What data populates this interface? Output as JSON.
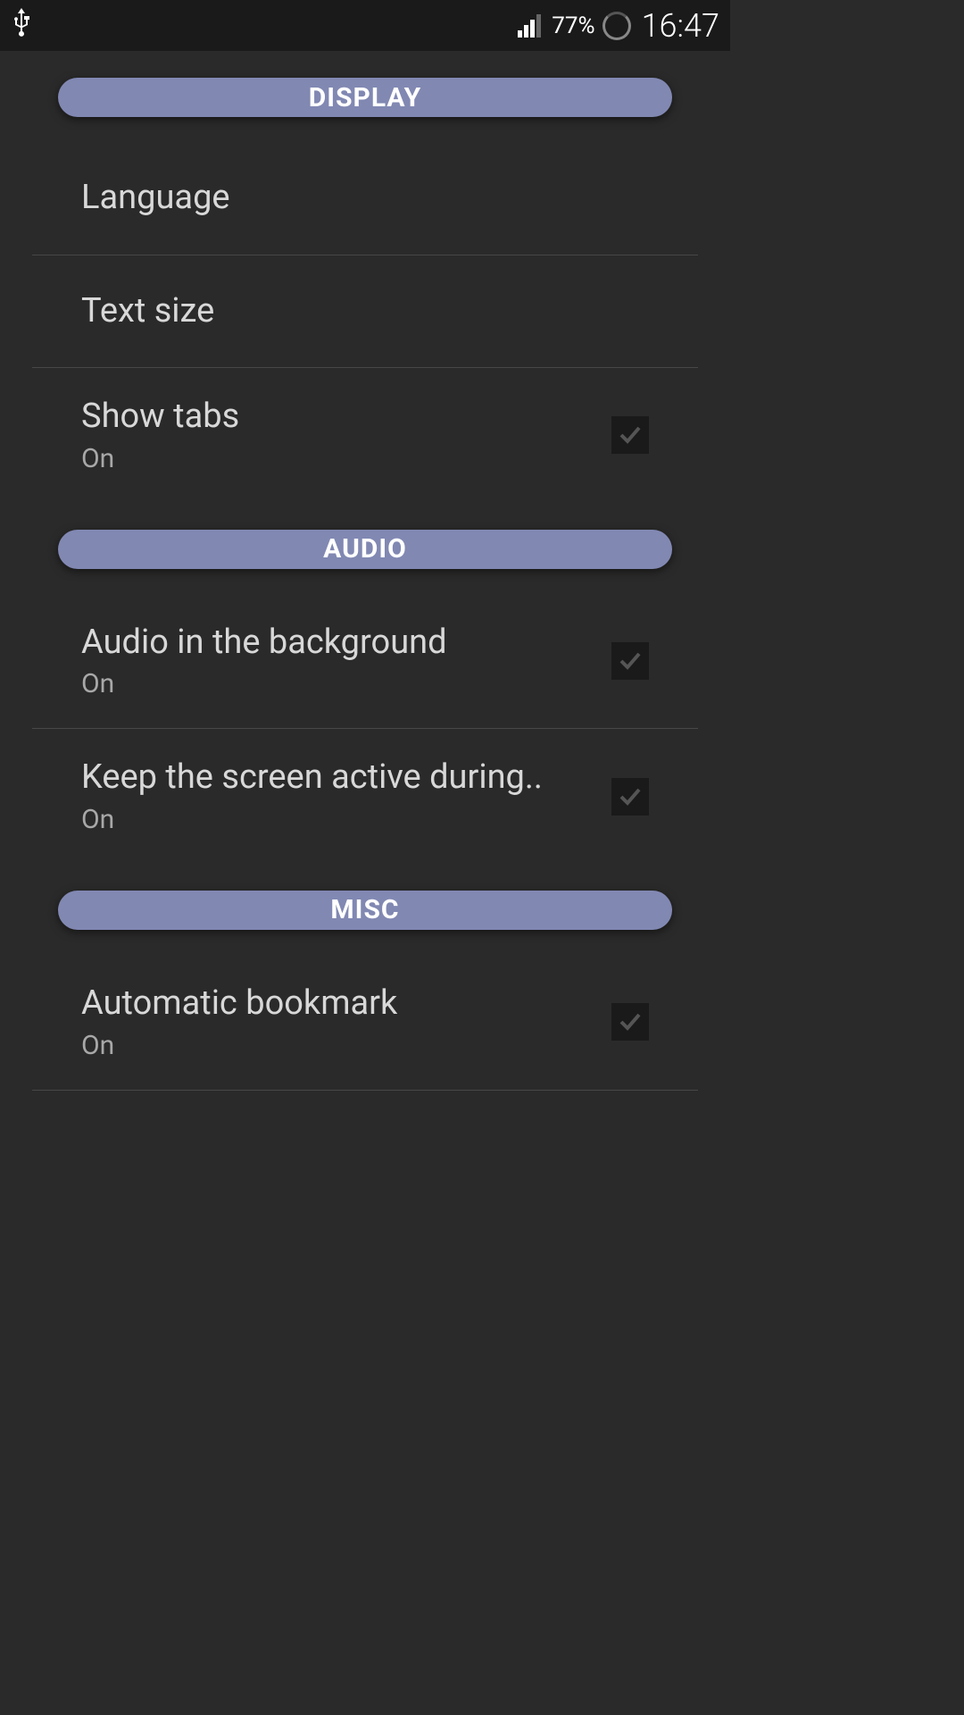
{
  "statusBar": {
    "batteryPercent": "77%",
    "time": "16:47"
  },
  "sections": {
    "display": {
      "header": "DISPLAY",
      "items": {
        "language": {
          "title": "Language"
        },
        "textSize": {
          "title": "Text size"
        },
        "showTabs": {
          "title": "Show tabs",
          "subtitle": "On",
          "checked": true
        }
      }
    },
    "audio": {
      "header": "AUDIO",
      "items": {
        "backgroundAudio": {
          "title": "Audio in the background",
          "subtitle": "On",
          "checked": true
        },
        "keepScreenActive": {
          "title": "Keep the screen active during..",
          "subtitle": "On",
          "checked": true
        }
      }
    },
    "misc": {
      "header": "MISC",
      "items": {
        "autoBookmark": {
          "title": "Automatic bookmark",
          "subtitle": "On",
          "checked": true
        }
      }
    }
  }
}
